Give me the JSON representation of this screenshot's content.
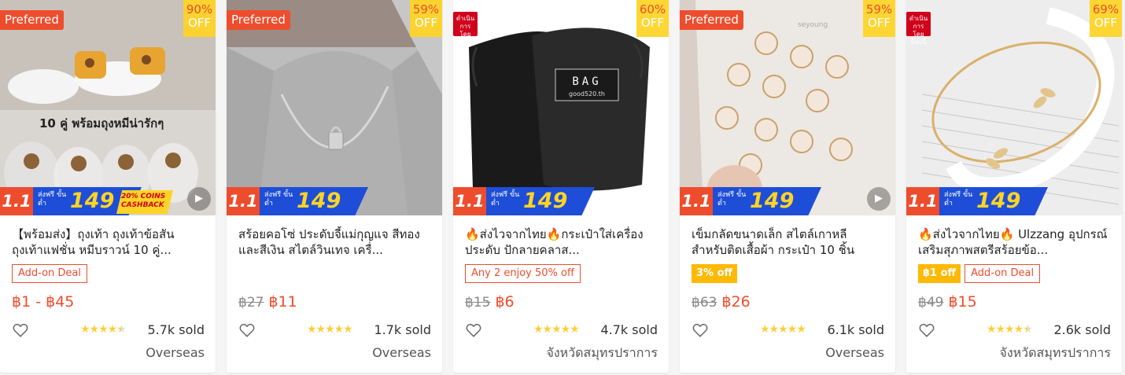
{
  "colors": {
    "primary": "#ee4d2d",
    "discount_bg": "#ffd424",
    "banner_blue": "#1e4ed8",
    "star": "#ffce3d",
    "mall_red": "#d0011b"
  },
  "banner": {
    "sale_label": "1.1",
    "free_ship_label": "ส่งฟรี ขั้นต่ำ",
    "free_ship_min": "149",
    "cashback_label": "20% COINS CASHBACK"
  },
  "products": [
    {
      "badge": "Preferred",
      "badge_type": "preferred",
      "discount_pct": "90%",
      "discount_off": "OFF",
      "image_text": "10 คู่ พร้อมถุงหมีน่ารักๆ",
      "has_video": true,
      "has_cashback": true,
      "title": "【พร้อมส่ง】ถุงเท้า ถุงเท้าข้อสัน ถุงเท้าแฟชั่น หมีบราวน์ 10 คู่...",
      "tags": [
        {
          "type": "outline",
          "text": "Add-on Deal"
        }
      ],
      "price_old": "",
      "price": "฿1 - ฿45",
      "rating": 4.5,
      "sold": "5.7k sold",
      "location": "Overseas"
    },
    {
      "badge": "Preferred",
      "badge_type": "preferred",
      "discount_pct": "59%",
      "discount_off": "OFF",
      "image_text": "",
      "has_video": false,
      "has_cashback": false,
      "title": "สร้อยคอโซ่ ประดับจี้แม่กุญแจ สีทองและสีเงิน สไตล์วินเทจ เครื่...",
      "tags": [],
      "price_old": "฿27",
      "price": "฿11",
      "rating": 5,
      "sold": "1.7k sold",
      "location": "Overseas"
    },
    {
      "badge": "ดำเนินการโดยช้อปปี้",
      "badge_type": "mall",
      "discount_pct": "60%",
      "discount_off": "OFF",
      "image_text": "B A G",
      "image_subtext": "good520.th",
      "has_video": false,
      "has_cashback": false,
      "title": "🔥ส่งไวจากไทย🔥กระเป๋าใส่เครื่องประดับ ปักลายคลาส...",
      "tags": [
        {
          "type": "outline",
          "text": "Any 2 enjoy 50% off"
        }
      ],
      "price_old": "฿15",
      "price": "฿6",
      "rating": 5,
      "sold": "4.7k sold",
      "location": "จังหวัดสมุทรปราการ"
    },
    {
      "badge": "Preferred",
      "badge_type": "preferred",
      "discount_pct": "59%",
      "discount_off": "OFF",
      "image_text": "",
      "has_video": true,
      "has_cashback": false,
      "title": "เข็มกลัดขนาดเล็ก สไตล์เกาหลี สำหรับติดเสื้อผ้า กระเป๋า 10 ชิ้น",
      "tags": [
        {
          "type": "solid",
          "text": "3% off"
        }
      ],
      "price_old": "฿63",
      "price": "฿26",
      "rating": 5,
      "sold": "6.1k sold",
      "location": "Overseas"
    },
    {
      "badge": "ดำเนินการโดยช้อปปี้",
      "badge_type": "mall",
      "discount_pct": "69%",
      "discount_off": "OFF",
      "image_text": "",
      "has_video": false,
      "has_cashback": false,
      "title": "🔥ส่งไวจากไทย🔥 Ulzzang อุปกรณ์เสริมสุภาพสตรีสร้อยข้อ...",
      "tags": [
        {
          "type": "solid",
          "text": "฿1 off"
        },
        {
          "type": "outline",
          "text": "Add-on Deal"
        }
      ],
      "price_old": "฿49",
      "price": "฿15",
      "rating": 4.5,
      "sold": "2.6k sold",
      "location": "จังหวัดสมุทรปราการ"
    }
  ]
}
